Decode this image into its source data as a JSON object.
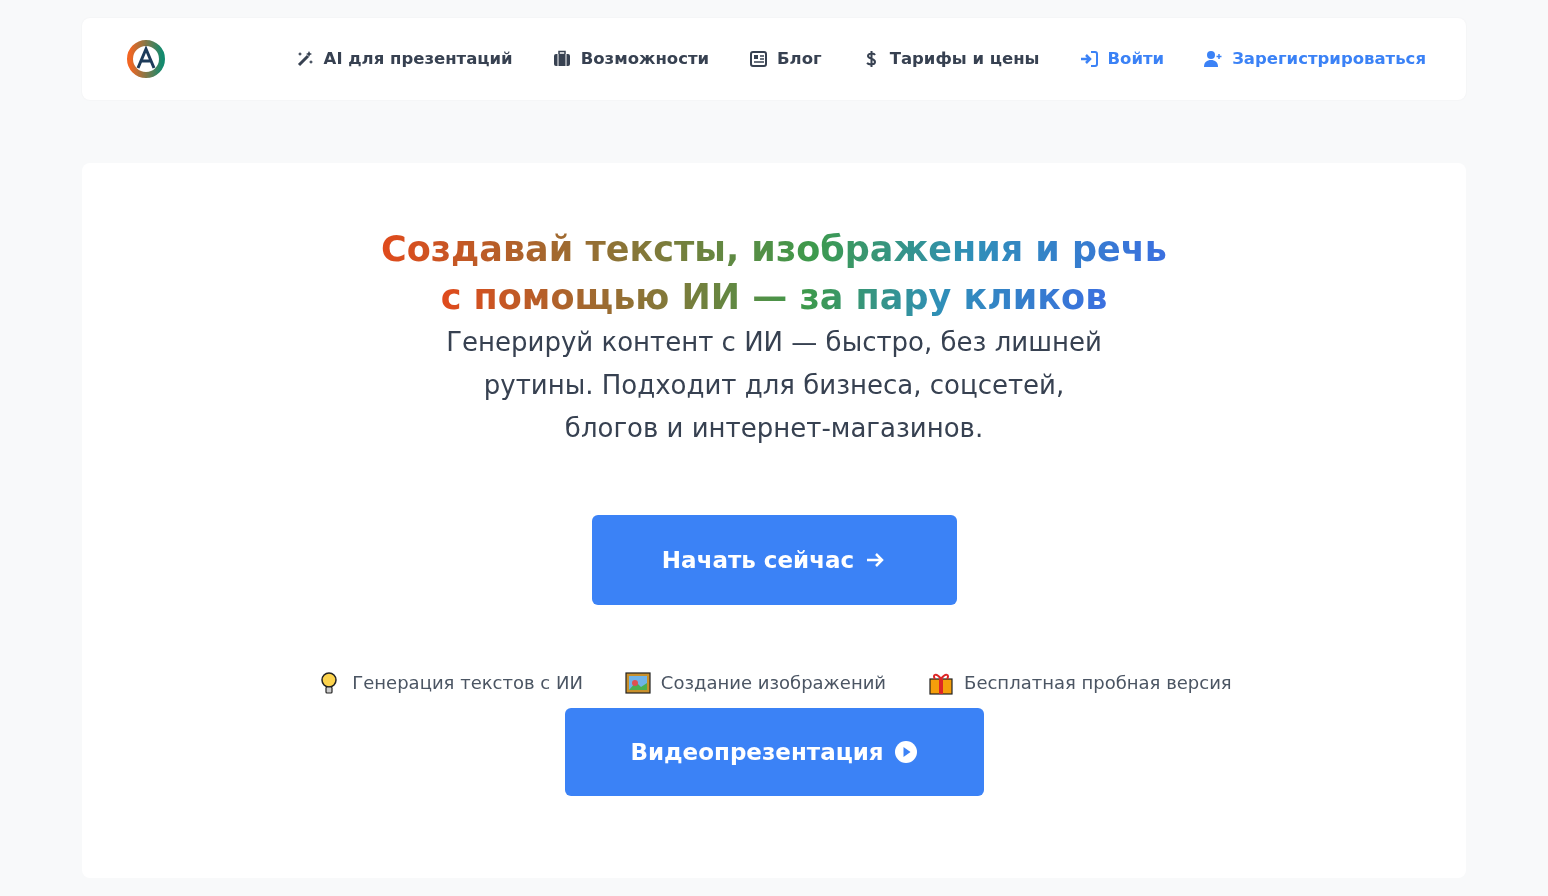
{
  "navbar": {
    "items": [
      {
        "label": "AI для презентаций",
        "kind": "wand",
        "highlight": false
      },
      {
        "label": "Возможности",
        "kind": "briefcase",
        "highlight": false
      },
      {
        "label": "Блог",
        "kind": "news",
        "highlight": false
      },
      {
        "label": "Тарифы и цены",
        "kind": "dollar",
        "highlight": false
      },
      {
        "label": "Войти",
        "kind": "login",
        "highlight": true
      },
      {
        "label": "Зарегистрироваться",
        "kind": "user-plus",
        "highlight": true
      }
    ]
  },
  "hero": {
    "headline": [
      "Создавай тексты, изображения и речь",
      "с помощью ИИ — за пару кликов"
    ],
    "subtitle": "Генерируй контент с ИИ — быстро, без лишней рутины. Подходит для бизнеса, соцсетей, блогов и интернет-магазинов.",
    "primary_button": {
      "label": "Начать сейчас",
      "kind": "arrow"
    },
    "features": [
      {
        "label": "Генерация текстов с ИИ",
        "kind": "bulb"
      },
      {
        "label": "Создание изображений",
        "kind": "image"
      },
      {
        "label": "Бесплатная пробная версия",
        "kind": "gift"
      }
    ],
    "video_button": {
      "label": "Видеопрезентация",
      "kind": "play"
    }
  }
}
